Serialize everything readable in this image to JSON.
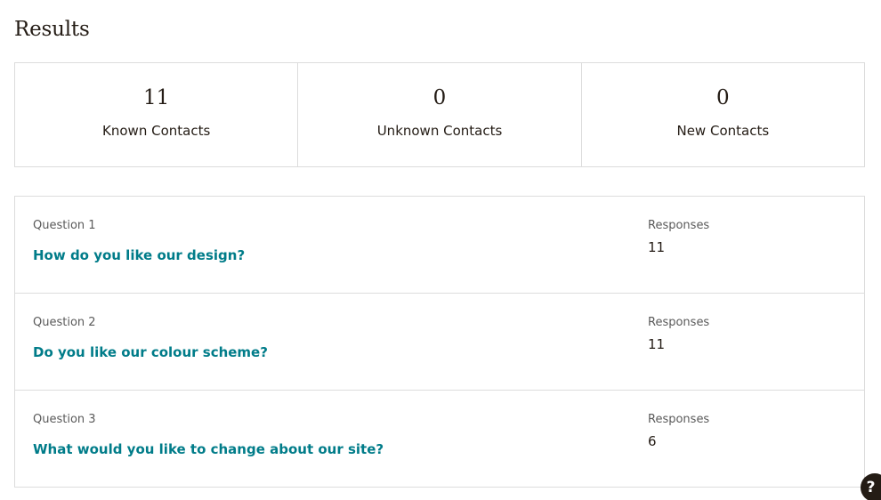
{
  "page": {
    "title": "Results"
  },
  "stats": [
    {
      "value": "11",
      "label": "Known Contacts"
    },
    {
      "value": "0",
      "label": "Unknown Contacts"
    },
    {
      "value": "0",
      "label": "New Contacts"
    }
  ],
  "questions": [
    {
      "label": "Question 1",
      "text": "How do you like our design?",
      "responses_label": "Responses",
      "responses": "11"
    },
    {
      "label": "Question 2",
      "text": "Do you like our colour scheme?",
      "responses_label": "Responses",
      "responses": "11"
    },
    {
      "label": "Question 3",
      "text": "What would you like to change about our site?",
      "responses_label": "Responses",
      "responses": "6"
    }
  ],
  "help": {
    "icon": "help-icon",
    "glyph": "?"
  },
  "colors": {
    "link": "#007c89",
    "text": "#241c15",
    "border": "#dcdcdc"
  }
}
